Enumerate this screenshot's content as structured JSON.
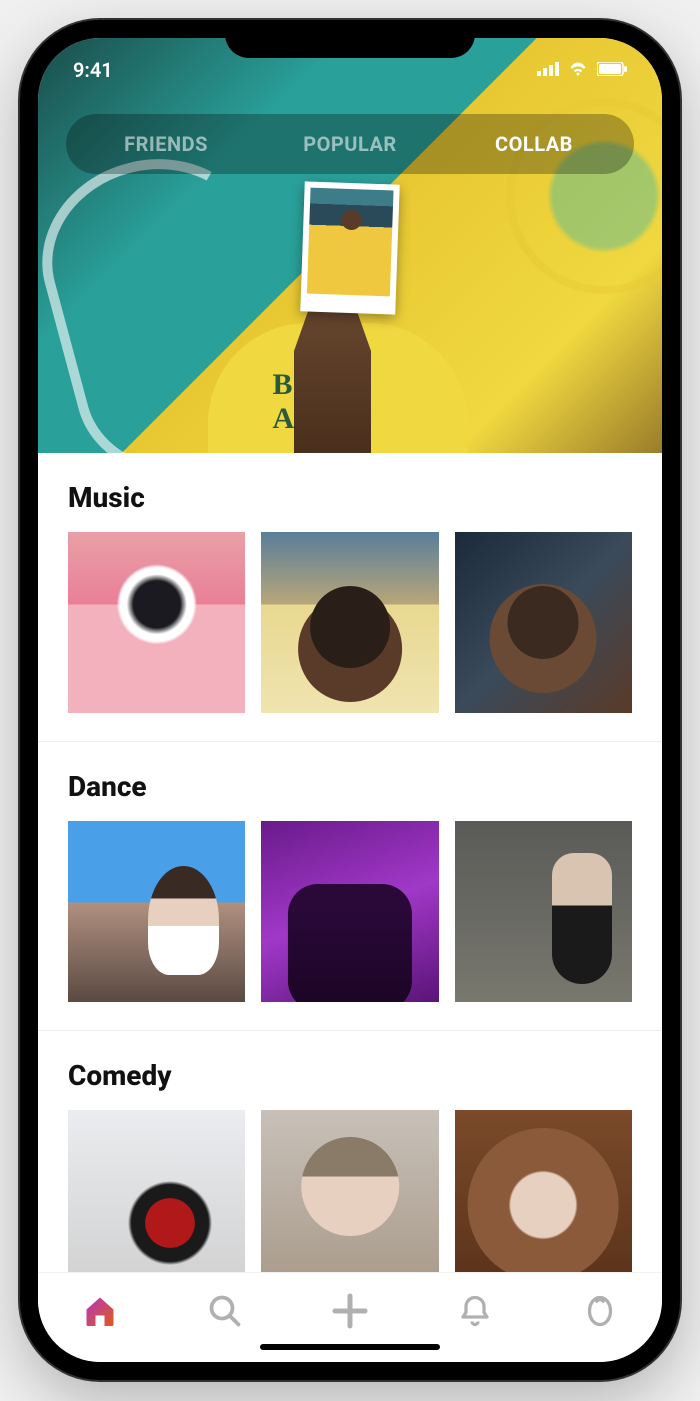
{
  "status": {
    "time": "9:41"
  },
  "tabs": [
    {
      "label": "FRIENDS",
      "active": false
    },
    {
      "label": "POPULAR",
      "active": false
    },
    {
      "label": "COLLAB",
      "active": true
    }
  ],
  "hero": {
    "jersey_text": "BEL-AIR"
  },
  "sections": [
    {
      "title": "Music",
      "thumbs": [
        "music-1",
        "music-2",
        "music-3"
      ]
    },
    {
      "title": "Dance",
      "thumbs": [
        "dance-1",
        "dance-2",
        "dance-3"
      ]
    },
    {
      "title": "Comedy",
      "thumbs": [
        "comedy-1",
        "comedy-2",
        "comedy-3"
      ]
    }
  ],
  "bottom_nav": [
    {
      "name": "home",
      "active": true
    },
    {
      "name": "search",
      "active": false
    },
    {
      "name": "add",
      "active": false
    },
    {
      "name": "alerts",
      "active": false
    },
    {
      "name": "profile",
      "active": false
    }
  ],
  "colors": {
    "accent_start": "#b038c0",
    "accent_end": "#e05a1a",
    "inactive": "#b0b0b0"
  }
}
